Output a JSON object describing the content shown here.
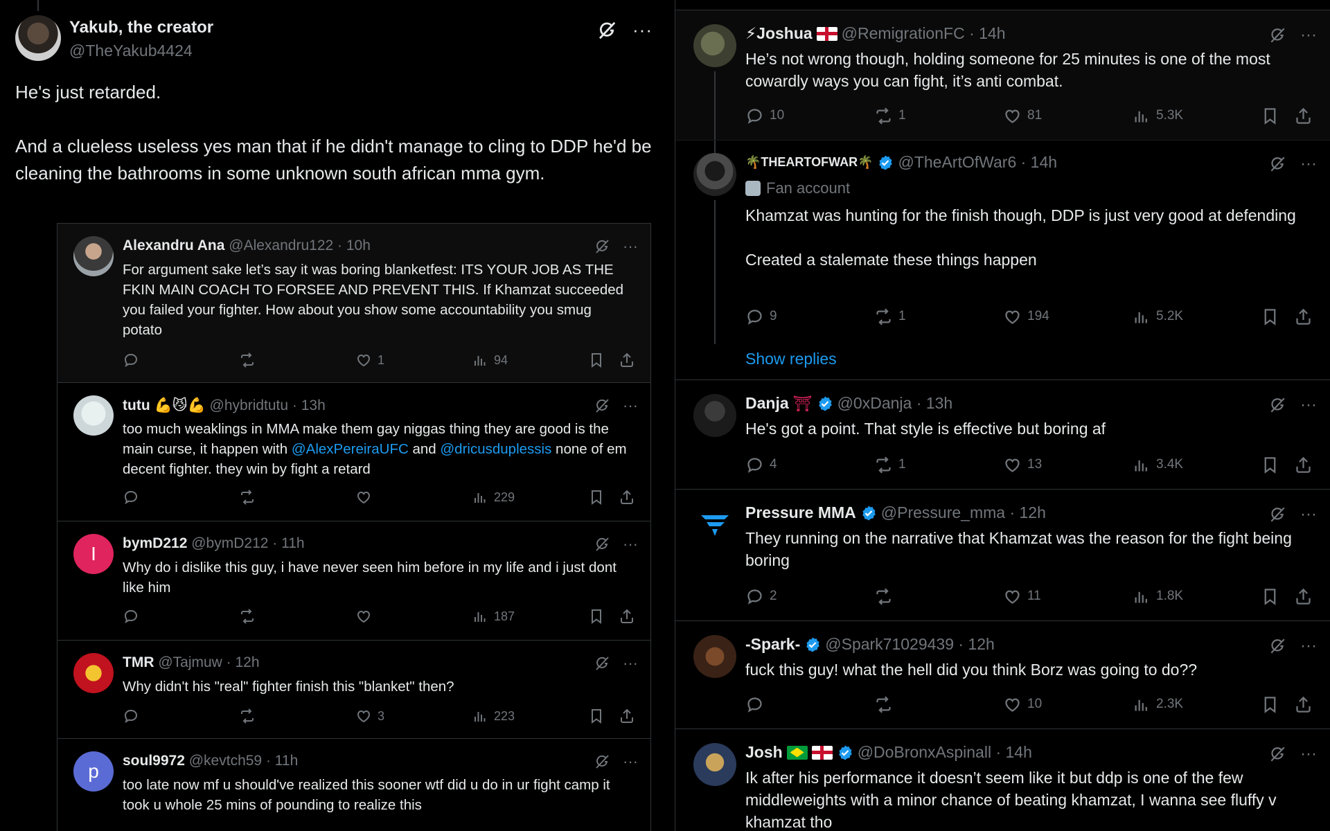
{
  "left": {
    "main_tweet": {
      "name": "Yakub, the creator",
      "handle": "@TheYakub4424",
      "text": "He's just retarded.\n\nAnd a clueless useless yes man that if he didn't manage to cling to DDP he'd be cleaning the bathrooms in some unknown south african mma gym."
    },
    "replies": [
      {
        "name": "Alexandru Ana",
        "handle_time": "@Alexandru122 · 10h",
        "text": "For argument sake let’s say it was boring blanketfest: ITS YOUR JOB AS THE FKIN MAIN COACH TO FORSEE AND PREVENT THIS. If Khamzat succeeded you failed your fighter. How about you show some accountability you smug potato",
        "reply_count": "",
        "repost_count": "",
        "like_count": "1",
        "view_count": "94"
      },
      {
        "name": "tutu",
        "name_emoji": "💪😼💪",
        "handle_time": "@hybridtutu · 13h",
        "text_before": "too much weaklings in MMA make them gay niggas thing they are good is the main curse, it happen with ",
        "mention1": "@AlexPereiraUFC",
        "text_mid": " and ",
        "mention2": "@dricusduplessis",
        "text_after": " none of em decent fighter. they win by fight a retard",
        "like_count": "",
        "view_count": "229"
      },
      {
        "name": "bymD212",
        "handle_time": "@bymD212 · 11h",
        "avatar_letter": "I",
        "text": "Why do i dislike this guy, i have never seen him before in my life and i just dont like him",
        "like_count": "",
        "view_count": "187"
      },
      {
        "name": "TMR",
        "handle_time": "@Tajmuw · 12h",
        "text": "Why didn't his \"real\" fighter finish this \"blanket\" then?",
        "like_count": "3",
        "view_count": "223"
      },
      {
        "name": "soul9972",
        "handle_time": "@kevtch59 · 11h",
        "avatar_letter": "p",
        "text": "too late now mf u should've realized this sooner wtf did u do in ur fight camp it took u whole 25 mins of pounding to realize this"
      }
    ]
  },
  "right": {
    "replies": [
      {
        "name": "⚡Joshua",
        "handle_time": "@RemigrationFC · 14h",
        "text": "He’s not wrong though, holding someone for 25 minutes is one of the most cowardly ways you can fight, it’s anti combat.",
        "reply_count": "10",
        "repost_count": "1",
        "like_count": "81",
        "view_count": "5.3K"
      },
      {
        "name": "🌴THEARTOFWAR🌴",
        "handle_time": "@TheArtOfWar6 · 14h",
        "badge": "Fan account",
        "text": "Khamzat was hunting for the finish though, DDP is just very good at defending\n\nCreated a stalemate these things happen",
        "reply_count": "9",
        "repost_count": "1",
        "like_count": "194",
        "view_count": "5.2K",
        "show_replies": "Show replies"
      },
      {
        "name": "Danja",
        "handle_time": "@0xDanja · 13h",
        "text": "He's got a point. That style is effective but boring af",
        "reply_count": "4",
        "repost_count": "1",
        "like_count": "13",
        "view_count": "3.4K"
      },
      {
        "name": "Pressure MMA",
        "handle_time": "@Pressure_mma · 12h",
        "text": "They running on the narrative that Khamzat was the reason for the fight being boring",
        "reply_count": "2",
        "repost_count": "",
        "like_count": "11",
        "view_count": "1.8K"
      },
      {
        "name": "-Spark-",
        "handle_time": "@Spark71029439 · 12h",
        "text": "fuck this guy! what the hell did you think Borz was going to do??",
        "reply_count": "",
        "repost_count": "",
        "like_count": "10",
        "view_count": "2.3K"
      },
      {
        "name": "Josh",
        "handle_time": "@DoBronxAspinall · 14h",
        "text": "Ik after his performance it doesn’t seem like it but ddp is one of the few middleweights with a minor chance of beating khamzat, I wanna see fluffy v khamzat tho"
      }
    ]
  },
  "colors": {
    "background": "#000000",
    "text": "#e7e9ea",
    "muted": "#71767b",
    "link": "#1d9bf0",
    "divider": "#2f3336"
  }
}
